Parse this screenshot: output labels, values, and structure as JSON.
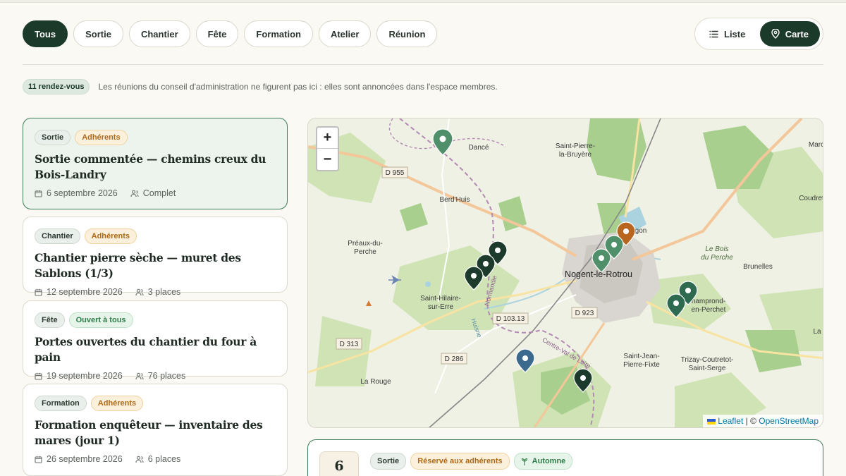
{
  "filters": [
    "Tous",
    "Sortie",
    "Chantier",
    "Fête",
    "Formation",
    "Atelier",
    "Réunion"
  ],
  "view_toggle": {
    "list_label": "Liste",
    "map_label": "Carte"
  },
  "count_badge": "11 rendez-vous",
  "count_note": "Les réunions du conseil d'administration ne figurent pas ici : elles sont annoncées dans l'espace membres.",
  "events": [
    {
      "type": "Sortie",
      "audience": "Adhérents",
      "title": "Sortie commentée — chemins creux du Bois-Landry",
      "date": "6 septembre 2026",
      "places": "Complet"
    },
    {
      "type": "Chantier",
      "audience": "Adhérents",
      "title": "Chantier pierre sèche — muret des Sablons (1/3)",
      "date": "12 septembre 2026",
      "places": "3 places"
    },
    {
      "type": "Fête",
      "audience": "Ouvert à tous",
      "title": "Portes ouvertes du chantier du four à pain",
      "date": "19 septembre 2026",
      "places": "76 places"
    },
    {
      "type": "Formation",
      "audience": "Adhérents",
      "title": "Formation enquêteur — inventaire des mares (jour 1)",
      "date": "26 septembre 2026",
      "places": "6 places"
    }
  ],
  "map": {
    "labels": {
      "dance": "Dancé",
      "saint_pierre": "Saint-Pierre-\nla-Bruyère",
      "berd_huis": "Berd'Huis",
      "preaux": "Préaux-du-\nPerche",
      "nogent": "Nogent-le-Rotrou",
      "margon": "gon",
      "bois_perche": "Le Bois\ndu Perche",
      "brunelles": "Brunelles",
      "st_hilaire": "Saint-Hilaire-\nsur-Erre",
      "champrond": "hamprond-\nen-Perchet",
      "st_jean": "Saint-Jean-\nPierre-Fixte",
      "trizay": "Trizay-Coutretot-\nSaint-Serge",
      "la_rouge": "La Rouge",
      "marc": "Marc",
      "coudret": "Coudret",
      "la_c": "La C",
      "normandie": "Normandie",
      "centre": "Centre-Val de Loire",
      "huisne": "Huisne",
      "d955": "D 955",
      "d10313": "D 103.13",
      "d923": "D 923",
      "d313": "D 313",
      "d286": "D 286"
    },
    "zoom_in": "+",
    "zoom_out": "−",
    "attribution_leaflet": "Leaflet",
    "attribution_sep": "| ©",
    "attribution_osm": "OpenStreetMap",
    "marker_colors": {
      "dark": "#1c3b2c",
      "green": "#4f8f6a",
      "orange": "#b7651f",
      "blue": "#3b6a8e"
    }
  },
  "preview": {
    "day": "6",
    "type": "Sortie",
    "audience": "Réservé aux adhérents",
    "season": "Automne"
  }
}
